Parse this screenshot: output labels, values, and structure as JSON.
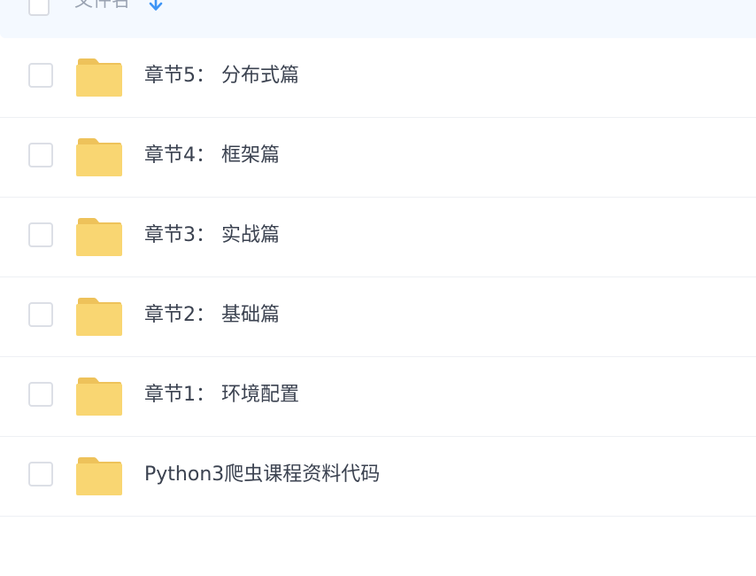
{
  "header": {
    "column_label": "文件名",
    "sort_icon": "arrow-down-icon",
    "sort_color": "#3e95f5"
  },
  "folder_color": "#f9d672",
  "files": [
    {
      "name": "章节5： 分布式篇",
      "icon": "folder-icon"
    },
    {
      "name": "章节4： 框架篇",
      "icon": "folder-icon"
    },
    {
      "name": "章节3： 实战篇",
      "icon": "folder-icon"
    },
    {
      "name": "章节2： 基础篇",
      "icon": "folder-icon"
    },
    {
      "name": "章节1： 环境配置",
      "icon": "folder-icon"
    },
    {
      "name": "Python3爬虫课程资料代码",
      "icon": "folder-icon"
    }
  ]
}
